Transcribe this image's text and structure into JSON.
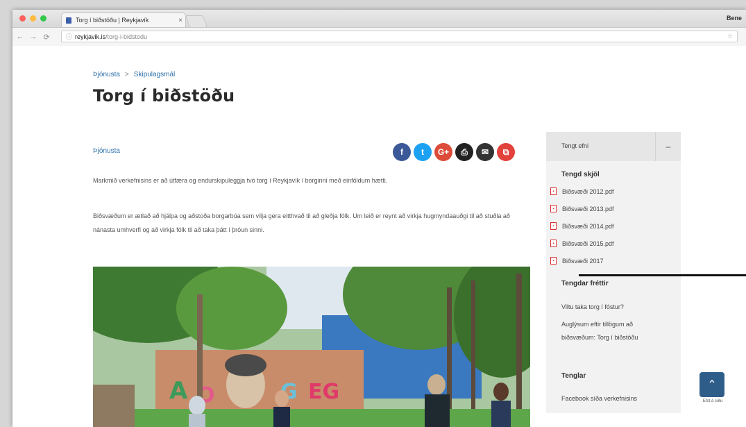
{
  "browser": {
    "tab_title": "Torg í biðstöðu | Reykjavík",
    "tab_close": "×",
    "user": "Bene",
    "url_host": "reykjavik.is",
    "url_path": "/torg-i-bidstodu",
    "nav_back": "←",
    "nav_forward": "→",
    "nav_reload": "⟳",
    "lock": "ⓘ",
    "bookmark_star": "☆"
  },
  "breadcrumb": {
    "items": [
      "Þjónusta",
      "Skipulagsmál"
    ],
    "separator": ">"
  },
  "page_title": "Torg í biðstöðu",
  "category": "Þjónusta",
  "share_buttons": [
    {
      "icon": "facebook-icon",
      "glyph": "f",
      "color": "#3b5998"
    },
    {
      "icon": "twitter-icon",
      "glyph": "t",
      "color": "#1da1f2"
    },
    {
      "icon": "googleplus-icon",
      "glyph": "G+",
      "color": "#dd4b39"
    },
    {
      "icon": "print-icon",
      "glyph": "⎙",
      "color": "#222222"
    },
    {
      "icon": "email-icon",
      "glyph": "✉",
      "color": "#333333"
    },
    {
      "icon": "pdf-icon",
      "glyph": "⧉",
      "color": "#e2423b"
    }
  ],
  "body": {
    "paragraph_1": "Markmið verkefnisins er að útfæra og endurskipuleggja tvö torg í Reykjavík í borginni með einföldum hætti.",
    "paragraph_2": "Biðsvæðum er ætlað að hjálpa og aðstoða borgarbúa sem vilja gera eitthvað til að gleðja fólk. Um leið er reynt að virkja hugmyndaauðgi til að stuðla að nánasta umhverfi og að virkja fólk til að taka þátt í þróun sinni."
  },
  "sidebar": {
    "title": "Tengt efni",
    "toggle": "–",
    "files_heading": "Tengd skjöl",
    "files": [
      "Biðsvæði 2012.pdf",
      "Biðsvæði 2013.pdf",
      "Biðsvæði 2014.pdf",
      "Biðsvæði 2015.pdf",
      "Biðsvæði 2017"
    ],
    "links_heading": "Tengdar fréttir",
    "links": [
      "Viltu taka torg í fóstur?",
      "Auglýsum eftir tillögum að biðsvæðum: Torg í biðstöðu"
    ],
    "tengslar_heading": "Tenglar",
    "tengslar": [
      "Facebook síða verkefnisins"
    ]
  },
  "scroll_top": {
    "glyph": "⌃",
    "label": "Efst á síðu"
  },
  "colors": {
    "link": "#2a6ea8",
    "scroll_button": "#2f5d8a"
  }
}
